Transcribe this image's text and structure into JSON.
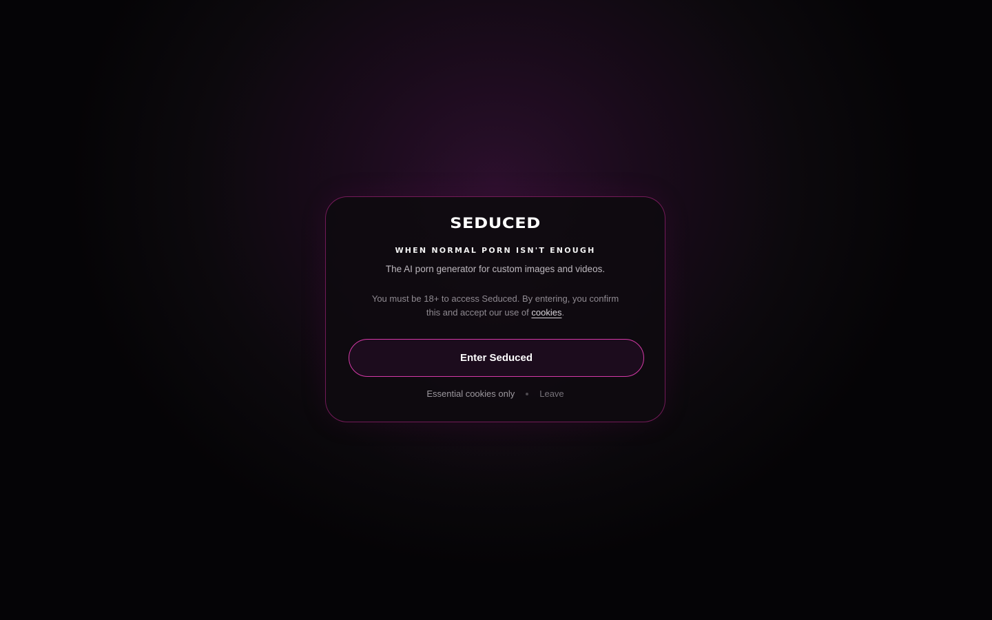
{
  "gate": {
    "logo": "SEDUCED",
    "tagline": "WHEN NORMAL PORN ISN'T ENOUGH",
    "subtitle": "The AI porn generator for custom images and videos.",
    "notice_prefix": "You must be 18+ to access Seduced. By entering, you confirm this and accept our use of ",
    "cookies_link": "cookies",
    "notice_suffix": ".",
    "enter_label": "Enter Seduced",
    "essential_label": "Essential cookies only",
    "leave_label": "Leave"
  },
  "colors": {
    "accent_border": "#d63aa8",
    "background": "#0c090d"
  }
}
